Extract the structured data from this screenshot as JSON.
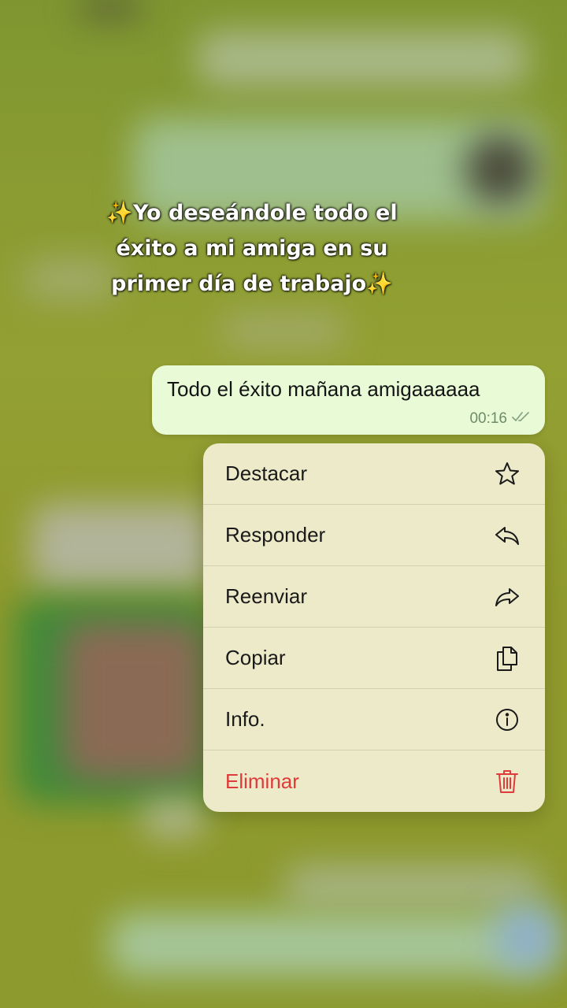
{
  "caption": {
    "sparkle": "✨",
    "line1": "Yo deseándole todo el",
    "line2": "éxito a mi amiga en su",
    "line3": "primer día de trabajo"
  },
  "message": {
    "text": "Todo el éxito mañana amigaaaaaa",
    "time": "00:16",
    "status_icon": "double-check-icon"
  },
  "menu": {
    "items": [
      {
        "label": "Destacar",
        "icon": "star-icon"
      },
      {
        "label": "Responder",
        "icon": "reply-icon"
      },
      {
        "label": "Reenviar",
        "icon": "forward-icon"
      },
      {
        "label": "Copiar",
        "icon": "copy-icon"
      },
      {
        "label": "Info.",
        "icon": "info-icon"
      },
      {
        "label": "Eliminar",
        "icon": "trash-icon",
        "danger": true
      }
    ]
  },
  "colors": {
    "bubble": "#e8fbd6",
    "menu_bg": "#eceac8",
    "danger": "#e03a3a",
    "backdrop": "#8f9a2c"
  }
}
